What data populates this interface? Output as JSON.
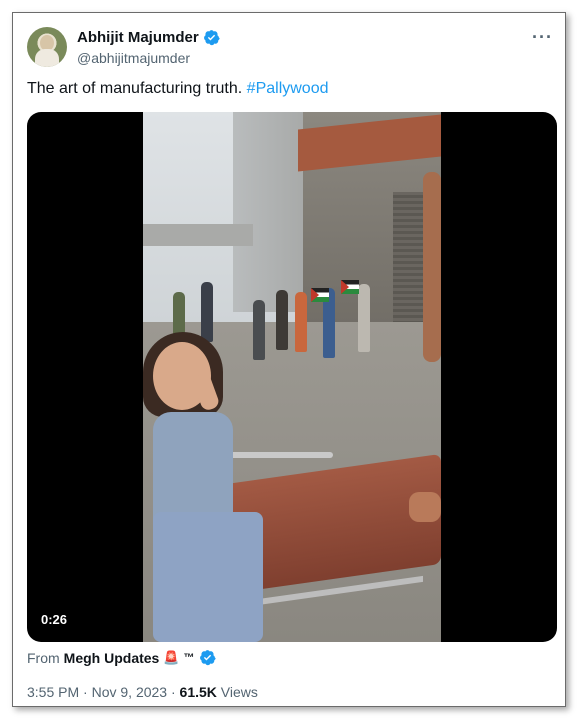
{
  "tweet": {
    "author_name": "Abhijit Majumder",
    "author_handle": "@abhijitmajumder",
    "text": "The art of manufacturing truth.",
    "hashtag": "#Pallywood",
    "video_duration": "0:26",
    "from_label": "From",
    "source_name": "Megh Updates",
    "source_emoji": "🚨",
    "source_tm": "™",
    "time": "3:55 PM",
    "separator": "·",
    "date": "Nov 9, 2023",
    "views_count": "61.5K",
    "views_label": "Views"
  },
  "colors": {
    "accent": "#1d9bf0",
    "secondary_text": "#536471",
    "primary_text": "#0f1419"
  },
  "icons": {
    "verified": "verified-badge-icon",
    "more": "more-options-icon"
  }
}
